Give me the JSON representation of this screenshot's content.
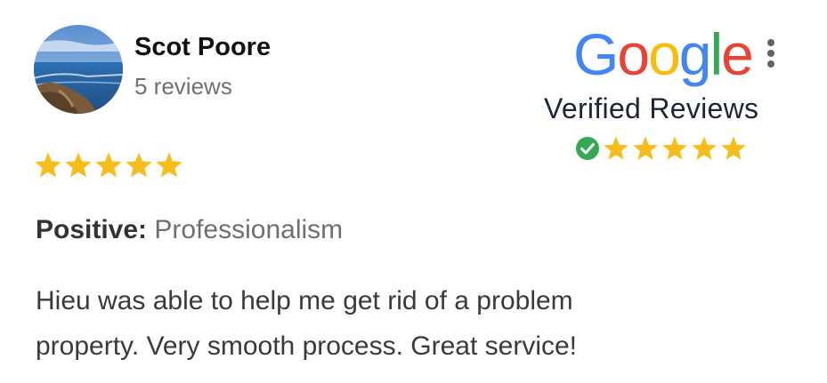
{
  "reviewer": {
    "name": "Scot Poore",
    "review_count": "5 reviews",
    "avatar_icon": "landscape-photo-avatar"
  },
  "rating": {
    "stars": 5,
    "max_stars": 5,
    "star_color": "#F7BE1B"
  },
  "positive": {
    "label": "Positive:",
    "value": "Professionalism"
  },
  "review": {
    "lines": [
      "Hieu was able to help me get rid of a problem",
      "property. Very smooth process. Great service!"
    ]
  },
  "badge": {
    "logo_letters": [
      "G",
      "o",
      "o",
      "g",
      "l",
      "e"
    ],
    "logo_colors": [
      "#4285F4",
      "#EA4335",
      "#FBBC05",
      "#4285F4",
      "#34A853",
      "#EA4335"
    ],
    "title": "Verified Reviews",
    "check_icon": "green-check-circle-icon",
    "check_color": "#34A853",
    "stars": 5,
    "menu_icon": "kebab-menu-icon"
  }
}
